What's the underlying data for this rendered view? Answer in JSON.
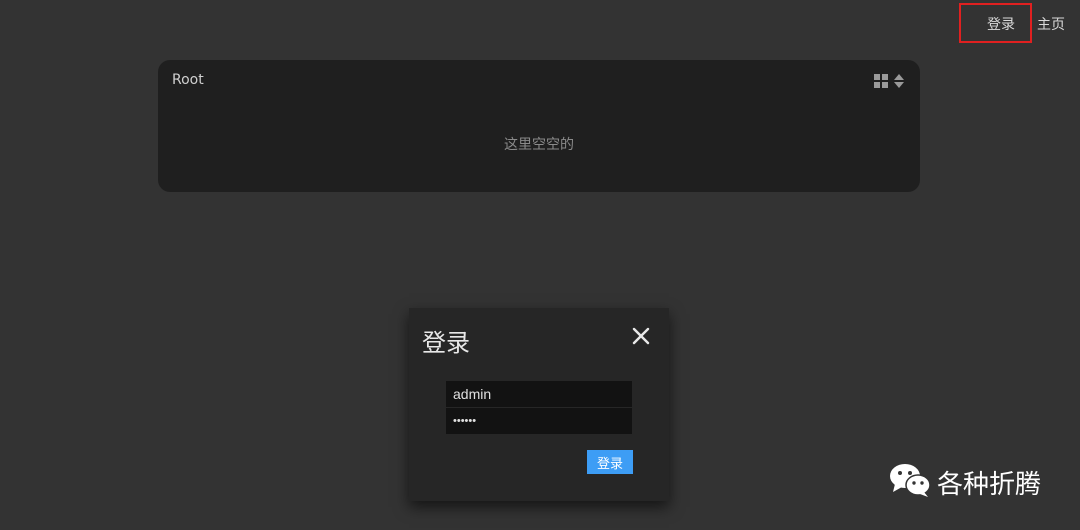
{
  "nav": {
    "login_label": "登录",
    "home_label": "主页",
    "highlight_color": "#e02020"
  },
  "folder": {
    "title": "Root",
    "empty_message": "这里空空的",
    "tools": [
      "grid-view-icon",
      "sort-icon"
    ]
  },
  "login_modal": {
    "title": "登录",
    "close_icon": "close-icon",
    "username_value": "admin",
    "password_value": "••••••",
    "submit_label": "登录",
    "submit_color": "#3d9df5"
  },
  "watermark": {
    "icon": "wechat-icon",
    "text": "各种折腾"
  }
}
